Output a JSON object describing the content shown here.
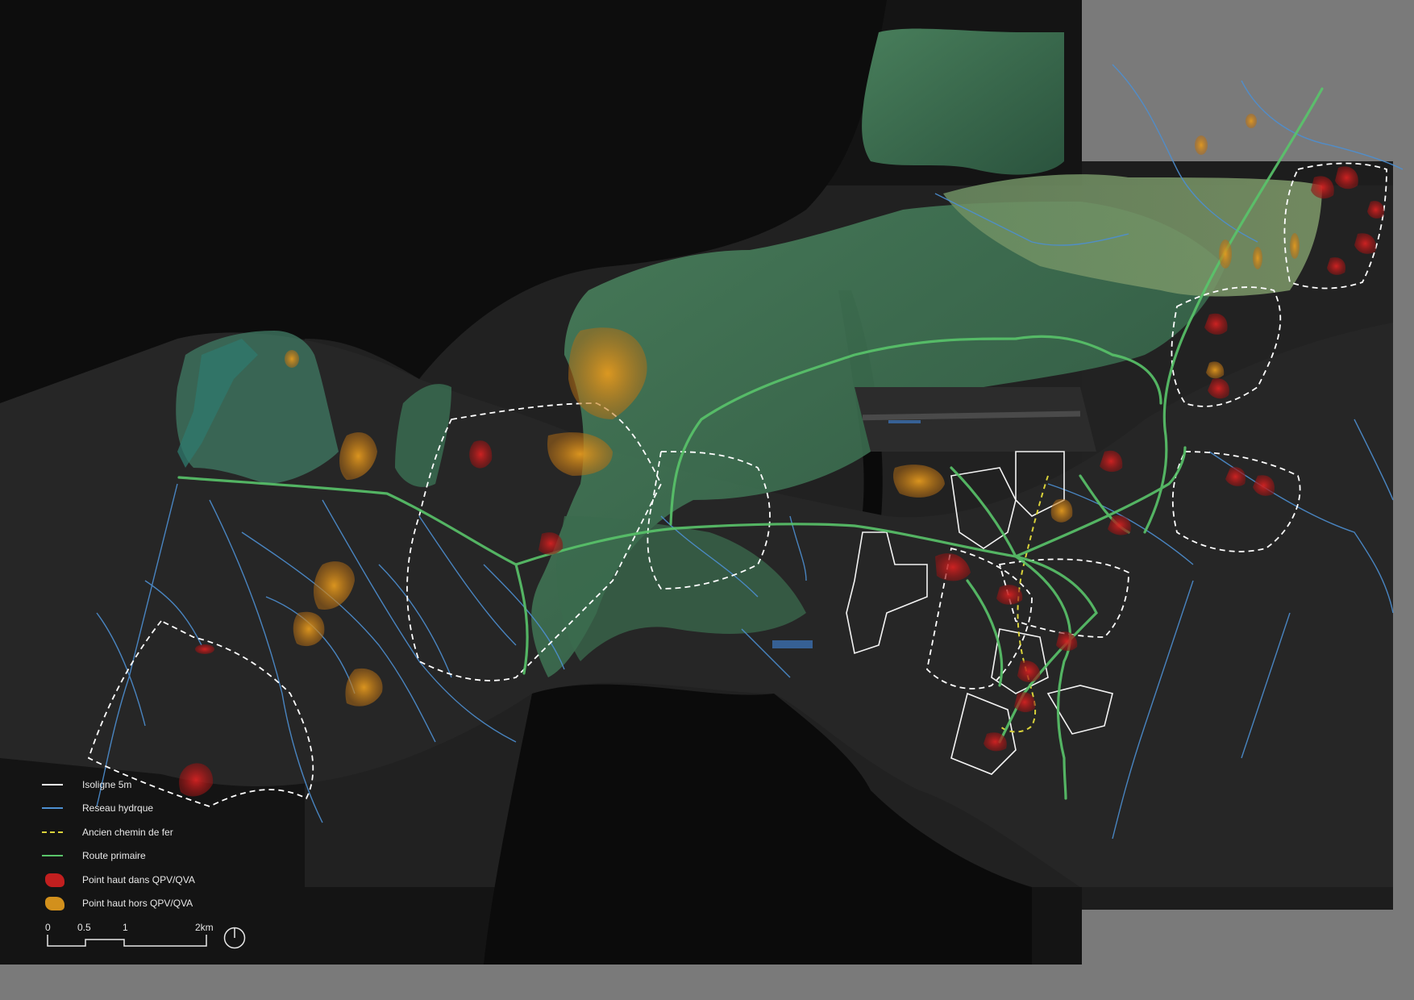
{
  "legend": {
    "items": [
      {
        "label": "Isoligne 5m",
        "color": "#ffffff",
        "style": "line"
      },
      {
        "label": "Reseau hydrque",
        "color": "#4d8fd1",
        "style": "line"
      },
      {
        "label": "Ancien chemin de fer",
        "color": "#d9d23a",
        "style": "dashed"
      },
      {
        "label": "Route primaire",
        "color": "#59c46a",
        "style": "line"
      },
      {
        "label": "Point haut dans QPV/QVA",
        "color": "#c21f1f",
        "style": "blob"
      },
      {
        "label": "Point haut hors QPV/QVA",
        "color": "#d2901c",
        "style": "blob"
      }
    ]
  },
  "scale_bar": {
    "labels": [
      "0",
      "0.5",
      "1",
      "2km"
    ]
  },
  "north_arrow": {
    "icon": "north-arrow-icon"
  },
  "colors": {
    "background": "#0f0f0f",
    "land_dark": "#1c1c1c",
    "vegetation": "#3d6e52",
    "water": "#0a0a0a",
    "outer_margin": "#7a7a7a"
  }
}
